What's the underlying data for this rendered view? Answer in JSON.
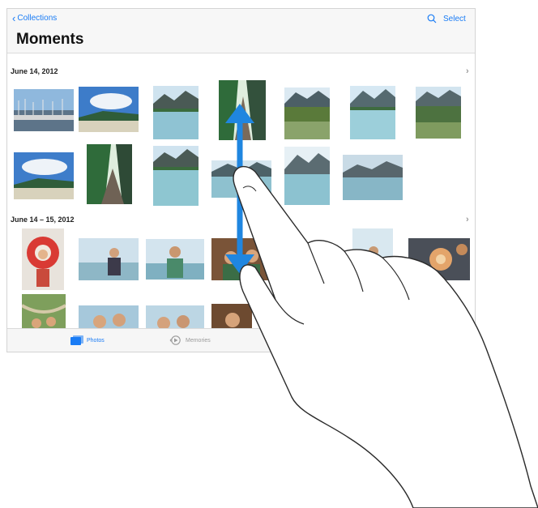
{
  "nav": {
    "back_label": "Collections",
    "select_label": "Select",
    "search_icon": "search-icon"
  },
  "title": "Moments",
  "sections": [
    {
      "header": "June 14, 2012"
    },
    {
      "header": "June 14 – 15, 2012"
    }
  ],
  "tabs": [
    {
      "label": "Photos",
      "icon": "photos-icon",
      "selected": true
    },
    {
      "label": "Memories",
      "icon": "memories-icon",
      "selected": false
    }
  ],
  "colors": {
    "accent": "#1a7cf5",
    "gesture_arrow": "#1f86e0",
    "tab_inactive": "#9a9a9a"
  }
}
